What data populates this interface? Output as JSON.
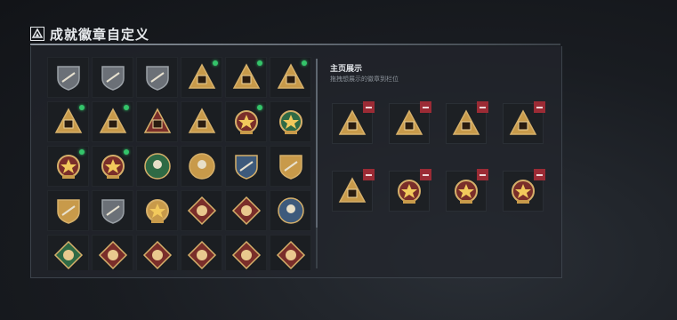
{
  "header": {
    "title": "成就徽章自定义",
    "icon": "triangle-emblem-icon"
  },
  "colors": {
    "new_dot": "#34c46a",
    "remove_button": "#9b2b35",
    "gold": "#c89a4a",
    "grey_badge": "#6b7077",
    "red_diamond": "#7a2e2a",
    "green_badge": "#2f6a45"
  },
  "badge_grid": {
    "rows": [
      [
        {
          "icon": "grey-shield-skull-icon",
          "new": false
        },
        {
          "icon": "grey-shield-helmet-icon",
          "new": false
        },
        {
          "icon": "grey-shield-arrow-icon",
          "new": false
        },
        {
          "icon": "gold-triangle-helmet-icon",
          "new": true
        },
        {
          "icon": "gold-triangle-bag-icon",
          "new": true
        },
        {
          "icon": "gold-triangle-bag-icon",
          "new": true
        }
      ],
      [
        {
          "icon": "gold-triangle-box-icon",
          "new": true
        },
        {
          "icon": "gold-triangle-box-icon",
          "new": true
        },
        {
          "icon": "red-triangle-tower-icon",
          "new": false
        },
        {
          "icon": "gold-triangle-ruins-icon",
          "new": false
        },
        {
          "icon": "red-star-medal-icon",
          "new": true
        },
        {
          "icon": "green-shield-medal-icon",
          "new": false
        }
      ],
      [
        {
          "icon": "red-gold-crest-icon",
          "new": true
        },
        {
          "icon": "red-gold-crest-icon",
          "new": true
        },
        {
          "icon": "green-skull-disc-icon",
          "new": false
        },
        {
          "icon": "gold-skull-disc-icon",
          "new": false
        },
        {
          "icon": "blue-shield-rifle-icon",
          "new": false
        },
        {
          "icon": "gold-shield-pistol-icon",
          "new": false
        }
      ],
      [
        {
          "icon": "gold-shield-rifle-icon",
          "new": false
        },
        {
          "icon": "grey-shield-rifle-icon",
          "new": false
        },
        {
          "icon": "gold-eagle-crest-icon",
          "new": false
        },
        {
          "icon": "red-diamond-beast-icon",
          "new": false
        },
        {
          "icon": "red-diamond-beast-icon",
          "new": false
        },
        {
          "icon": "blue-disc-wolf-icon",
          "new": false
        }
      ],
      [
        {
          "icon": "green-diamond-hands-icon",
          "new": false
        },
        {
          "icon": "red-diamond-runner-icon",
          "new": false
        },
        {
          "icon": "red-diamond-runner-icon",
          "new": false
        },
        {
          "icon": "red-diamond-runner-icon",
          "new": false
        },
        {
          "icon": "red-diamond-runner-icon",
          "new": false
        },
        {
          "icon": "red-diamond-runner-icon",
          "new": false
        }
      ]
    ]
  },
  "showcase": {
    "title": "主页展示",
    "subtitle": "拖拽想展示的徽章到栏位",
    "slots": [
      {
        "icon": "gold-triangle-helmet-icon"
      },
      {
        "icon": "gold-triangle-bag-icon"
      },
      {
        "icon": "gold-triangle-box-icon"
      },
      {
        "icon": "gold-triangle-ruins-icon"
      },
      {
        "icon": "gold-triangle-box-icon"
      },
      {
        "icon": "red-star-medal-icon"
      },
      {
        "icon": "red-gold-crest-icon"
      },
      {
        "icon": "red-gold-crest-icon"
      }
    ]
  }
}
